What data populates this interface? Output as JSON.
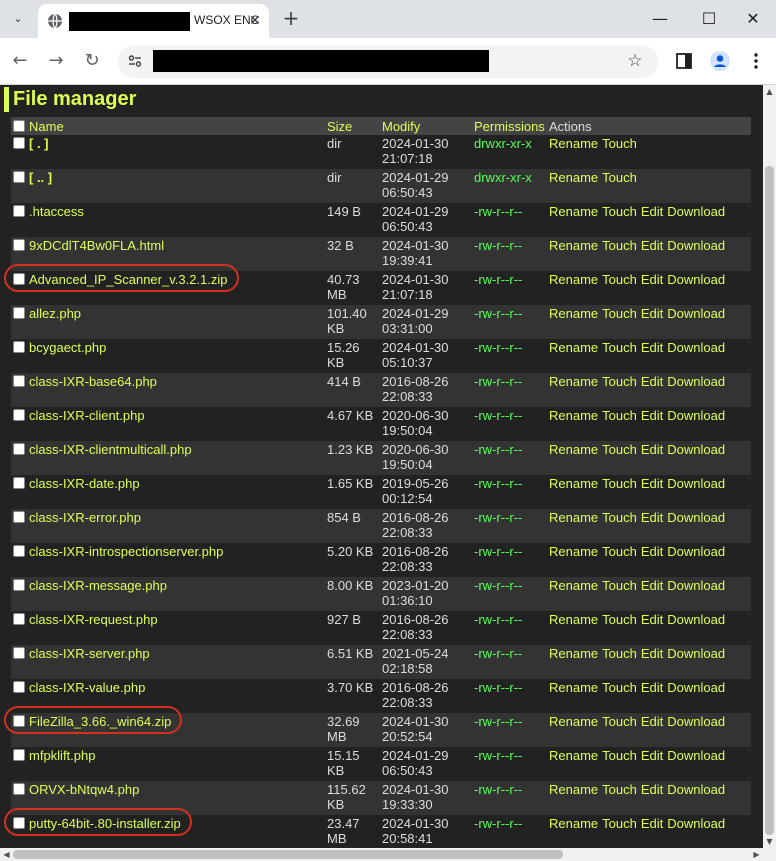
{
  "browser": {
    "tab_title": "WSOX ENC",
    "tab_close": "✕",
    "new_tab": "+",
    "window": {
      "minimize": "—",
      "maximize": "☐",
      "close": "✕"
    },
    "tab_dropdown": "⌄",
    "nav": {
      "back": "←",
      "forward": "→",
      "reload": "↻"
    },
    "star": "☆"
  },
  "page": {
    "title": "File manager",
    "columns": {
      "name": "Name",
      "size": "Size",
      "modify": "Modify",
      "permissions": "Permissions",
      "actions": "Actions"
    },
    "action_labels": {
      "rename": "Rename",
      "touch": "Touch",
      "edit": "Edit",
      "download": "Download"
    },
    "rows": [
      {
        "name": "[ . ]",
        "type": "dir",
        "size": "dir",
        "date": "2024-01-30",
        "time": "21:07:18",
        "perm": "drwxr-xr-x"
      },
      {
        "name": "[ .. ]",
        "type": "dir",
        "size": "dir",
        "date": "2024-01-29",
        "time": "06:50:43",
        "perm": "drwxr-xr-x"
      },
      {
        "name": ".htaccess",
        "type": "file",
        "size": "149 B",
        "date": "2024-01-29",
        "time": "06:50:43",
        "perm": "-rw-r--r--"
      },
      {
        "name": "9xDCdlT4Bw0FLA.html",
        "type": "file",
        "size": "32 B",
        "date": "2024-01-30",
        "time": "19:39:41",
        "perm": "-rw-r--r--"
      },
      {
        "name": "Advanced_IP_Scanner_v.3.2.1.zip",
        "type": "file",
        "size": "40.73 MB",
        "date": "2024-01-30",
        "time": "21:07:18",
        "perm": "-rw-r--r--",
        "highlight": true
      },
      {
        "name": "allez.php",
        "type": "file",
        "size": "101.40 KB",
        "date": "2024-01-29",
        "time": "03:31:00",
        "perm": "-rw-r--r--"
      },
      {
        "name": "bcygaect.php",
        "type": "file",
        "size": "15.26 KB",
        "date": "2024-01-30",
        "time": "05:10:37",
        "perm": "-rw-r--r--"
      },
      {
        "name": "class-IXR-base64.php",
        "type": "file",
        "size": "414 B",
        "date": "2016-08-26",
        "time": "22:08:33",
        "perm": "-rw-r--r--"
      },
      {
        "name": "class-IXR-client.php",
        "type": "file",
        "size": "4.67 KB",
        "date": "2020-06-30",
        "time": "19:50:04",
        "perm": "-rw-r--r--"
      },
      {
        "name": "class-IXR-clientmulticall.php",
        "type": "file",
        "size": "1.23 KB",
        "date": "2020-06-30",
        "time": "19:50:04",
        "perm": "-rw-r--r--"
      },
      {
        "name": "class-IXR-date.php",
        "type": "file",
        "size": "1.65 KB",
        "date": "2019-05-26",
        "time": "00:12:54",
        "perm": "-rw-r--r--"
      },
      {
        "name": "class-IXR-error.php",
        "type": "file",
        "size": "854 B",
        "date": "2016-08-26",
        "time": "22:08:33",
        "perm": "-rw-r--r--"
      },
      {
        "name": "class-IXR-introspectionserver.php",
        "type": "file",
        "size": "5.20 KB",
        "date": "2016-08-26",
        "time": "22:08:33",
        "perm": "-rw-r--r--"
      },
      {
        "name": "class-IXR-message.php",
        "type": "file",
        "size": "8.00 KB",
        "date": "2023-01-20",
        "time": "01:36:10",
        "perm": "-rw-r--r--"
      },
      {
        "name": "class-IXR-request.php",
        "type": "file",
        "size": "927 B",
        "date": "2016-08-26",
        "time": "22:08:33",
        "perm": "-rw-r--r--"
      },
      {
        "name": "class-IXR-server.php",
        "type": "file",
        "size": "6.51 KB",
        "date": "2021-05-24",
        "time": "02:18:58",
        "perm": "-rw-r--r--"
      },
      {
        "name": "class-IXR-value.php",
        "type": "file",
        "size": "3.70 KB",
        "date": "2016-08-26",
        "time": "22:08:33",
        "perm": "-rw-r--r--"
      },
      {
        "name": "FileZilla_3.66._win64.zip",
        "type": "file",
        "size": "32.69 MB",
        "date": "2024-01-30",
        "time": "20:52:54",
        "perm": "-rw-r--r--",
        "highlight": true
      },
      {
        "name": "mfpklift.php",
        "type": "file",
        "size": "15.15 KB",
        "date": "2024-01-29",
        "time": "06:50:43",
        "perm": "-rw-r--r--"
      },
      {
        "name": "ORVX-bNtqw4.php",
        "type": "file",
        "size": "115.62 KB",
        "date": "2024-01-30",
        "time": "19:33:30",
        "perm": "-rw-r--r--"
      },
      {
        "name": "putty-64bit-.80-installer.zip",
        "type": "file",
        "size": "23.47 MB",
        "date": "2024-01-30",
        "time": "20:58:41",
        "perm": "-rw-r--r--",
        "highlight": true
      }
    ]
  }
}
